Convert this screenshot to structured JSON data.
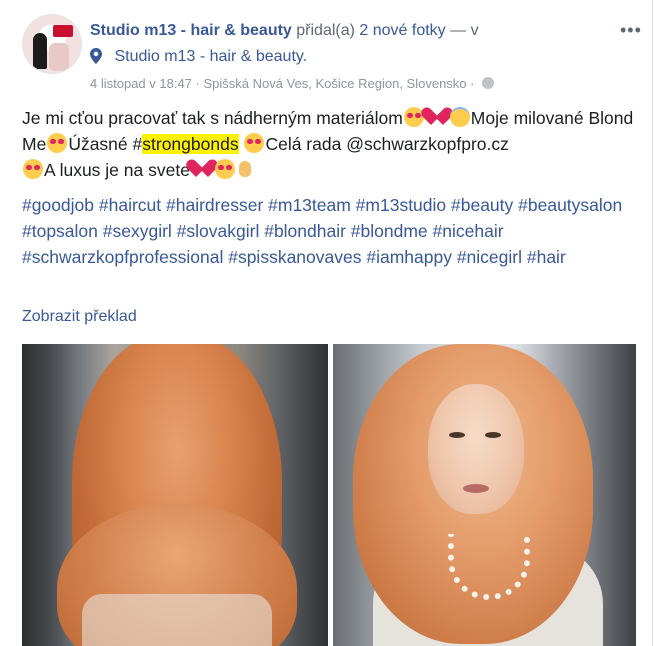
{
  "post": {
    "author": "Studio m13 - hair & beauty",
    "action_prefix": "přidal(a)",
    "action_link": "2 nové fotky",
    "action_suffix": "— v",
    "location": "Studio m13 - hair & beauty.",
    "timestamp": "4 listopad v 18:47",
    "separator": "·",
    "place": "Spišská Nová Ves, Košice Region, Slovensko",
    "privacy_separator": "·",
    "more_options": "•••",
    "text": {
      "part1": "Je mi cťou pracovať tak s nádherným materiálom",
      "part2": "Moje milované Blond Me",
      "part3": "Úžasné #",
      "highlight": "strongbonds",
      "part4": "Celá rada @schwarzkopfpro.cz",
      "part5": "A luxus je na svete"
    },
    "hashtags": "#goodjob #haircut #hairdresser #m13team #m13studio #beauty #beautysalon #topsalon #sexygirl #slovakgirl #blondhair #blondme #nicehair #schwarzkopfprofessional #spisskanovaves #iamhappy #nicegirl #hair",
    "translate_link": "Zobrazit překlad"
  },
  "icons": {
    "location": "location-pin-icon",
    "privacy": "globe-icon",
    "emoji_heart_eyes": "heart-eyes-emoji",
    "emoji_heart": "red-heart-emoji",
    "emoji_angel": "smiling-angel-emoji",
    "emoji_ok": "ok-hand-emoji"
  },
  "colors": {
    "link": "#385898",
    "meta": "#90949c",
    "highlight": "#fff200"
  }
}
